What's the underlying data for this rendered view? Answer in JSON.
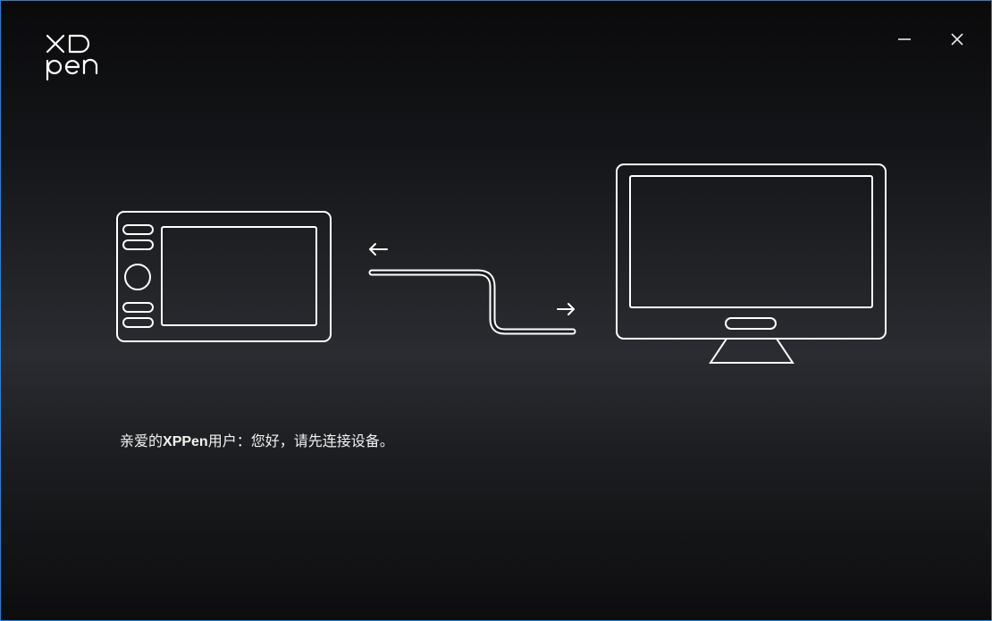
{
  "window": {
    "accent_border_color": "#2b7fd0",
    "background_colors": [
      "#0a0a0b",
      "#2a2c31",
      "#0d0d0e"
    ]
  },
  "header": {
    "logo_icon": "xppen-logo",
    "logo_text_top": "XP",
    "logo_text_bottom": "pen",
    "minimize_icon": "minimize-icon",
    "close_icon": "close-icon"
  },
  "illustration": {
    "left_device_icon": "drawing-tablet-icon",
    "cable_icon": "usb-cable-icon",
    "arrow_left_icon": "arrow-left-icon",
    "arrow_right_icon": "arrow-right-icon",
    "right_device_icon": "computer-monitor-icon",
    "stroke_color": "#ffffff"
  },
  "message": {
    "prefix": "亲爱的",
    "brand": "XPPen",
    "suffix": "用户：您好，请先连接设备。"
  }
}
